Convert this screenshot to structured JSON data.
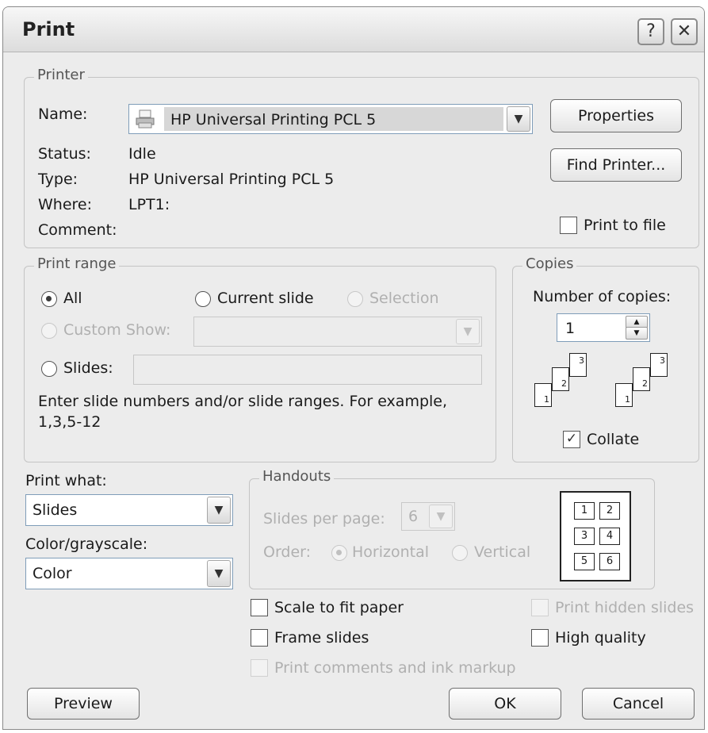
{
  "dialog": {
    "title": "Print",
    "help_glyph": "?",
    "close_glyph": "✕"
  },
  "printer": {
    "legend": "Printer",
    "name_label": "Name:",
    "name_value": "HP Universal Printing PCL 5",
    "status_label": "Status:",
    "status_value": "Idle",
    "type_label": "Type:",
    "type_value": "HP Universal Printing PCL 5",
    "where_label": "Where:",
    "where_value": "LPT1:",
    "comment_label": "Comment:",
    "properties_button": "Properties",
    "find_printer_button": "Find Printer...",
    "print_to_file_label": "Print to file",
    "print_to_file_checked": false
  },
  "print_range": {
    "legend": "Print range",
    "all_label": "All",
    "current_slide_label": "Current slide",
    "selection_label": "Selection",
    "custom_show_label": "Custom Show:",
    "slides_label": "Slides:",
    "slides_value": "",
    "hint": "Enter slide numbers and/or slide ranges. For example,",
    "hint_example": "1,3,5-12",
    "selected": "All"
  },
  "copies": {
    "legend": "Copies",
    "number_label": "Number of copies:",
    "number_value": "1",
    "collate_label": "Collate",
    "collate_checked": true,
    "page_numbers": [
      "1",
      "2",
      "3"
    ]
  },
  "print_what": {
    "label": "Print what:",
    "value": "Slides"
  },
  "color": {
    "label": "Color/grayscale:",
    "value": "Color"
  },
  "handouts": {
    "legend": "Handouts",
    "slides_per_page_label": "Slides per page:",
    "slides_per_page_value": "6",
    "order_label": "Order:",
    "horizontal_label": "Horizontal",
    "vertical_label": "Vertical",
    "preview_numbers": [
      "1",
      "2",
      "3",
      "4",
      "5",
      "6"
    ]
  },
  "options": {
    "scale_to_fit": "Scale to fit paper",
    "frame_slides": "Frame slides",
    "print_comments": "Print comments and ink markup",
    "print_hidden": "Print hidden slides",
    "high_quality": "High quality"
  },
  "buttons": {
    "preview": "Preview",
    "ok": "OK",
    "cancel": "Cancel"
  },
  "colors": {
    "dialog_bg": "#ececec",
    "disabled_text": "#b0b0b0",
    "field_border": "#7f9db9"
  }
}
